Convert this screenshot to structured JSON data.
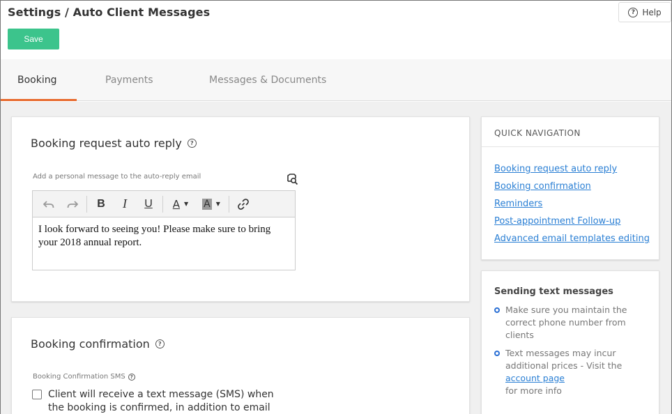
{
  "header": {
    "title": "Settings / Auto Client Messages",
    "help_label": "Help",
    "save_label": "Save"
  },
  "tabs": [
    {
      "label": "Booking",
      "active": true
    },
    {
      "label": "Payments",
      "active": false
    },
    {
      "label": "Messages & Documents",
      "active": false
    }
  ],
  "auto_reply": {
    "title": "Booking request auto reply",
    "field_label": "Add a personal message to the auto-reply email",
    "editor_text": "I look forward to seeing you! Please make sure to bring your 2018 annual report."
  },
  "toolbar": {
    "icons": [
      "undo-icon",
      "redo-icon",
      "bold-icon",
      "italic-icon",
      "underline-icon",
      "text-color-icon",
      "highlight-color-icon",
      "link-icon"
    ],
    "bold": "B",
    "italic": "I",
    "underline": "U",
    "text_color": "A",
    "highlight": "A"
  },
  "booking_confirmation": {
    "title": "Booking confirmation",
    "sms_label": "Booking Confirmation SMS",
    "checkbox_text": "Client will receive a text message (SMS) when the booking is confirmed, in addition to email",
    "checked": false
  },
  "quick_navigation": {
    "title": "QUICK NAVIGATION",
    "links": [
      "Booking request auto reply",
      "Booking confirmation",
      "Reminders",
      "Post-appointment Follow-up",
      "Advanced email templates editing"
    ]
  },
  "sending_text": {
    "title": "Sending text messages",
    "item1": "Make sure you maintain the correct phone number from clients",
    "item2_pre": "Text messages may incur additional prices - Visit the",
    "item2_link": "account page",
    "item2_post": "for more info"
  },
  "colors": {
    "save_button": "#3cc48c",
    "active_tab_underline": "#e8692c",
    "link": "#2a7fd4"
  }
}
